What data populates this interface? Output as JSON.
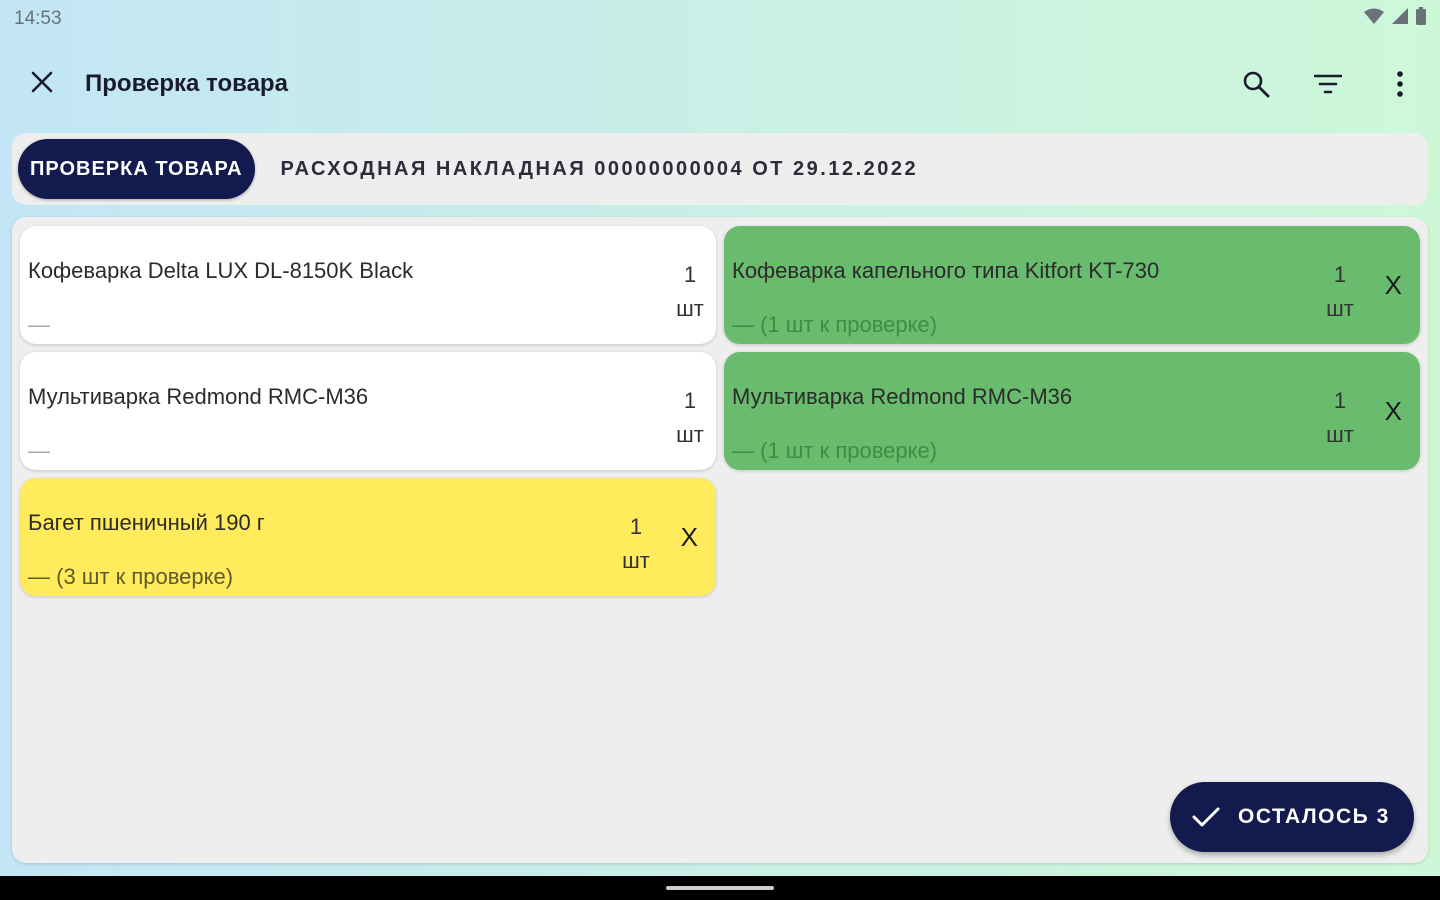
{
  "status_bar": {
    "time": "14:53",
    "icons": [
      "wifi-icon",
      "signal-icon",
      "battery-icon"
    ]
  },
  "app_bar": {
    "title": "Проверка товара",
    "actions": [
      "search-icon",
      "filter-icon",
      "more-vert-icon"
    ]
  },
  "header": {
    "chip_label": "ПРОВЕРКА ТОВАРА",
    "document_title": "РАСХОДНАЯ НАКЛАДНАЯ 00000000004 ОТ 29.12.2022"
  },
  "items": [
    {
      "name": "Кофеварка Delta LUX DL-8150K Black",
      "qty": "1",
      "unit": "шт",
      "sub": "—",
      "status": "white",
      "removable": false
    },
    {
      "name": "Кофеварка капельного типа Kitfort KT-730",
      "qty": "1",
      "unit": "шт",
      "sub": "— (1 шт к проверке)",
      "status": "green",
      "removable": true,
      "remove_label": "X"
    },
    {
      "name": "Мультиварка Redmond RMC-M36",
      "qty": "1",
      "unit": "шт",
      "sub": "—",
      "status": "white",
      "removable": false
    },
    {
      "name": "Мультиварка Redmond RMC-M36",
      "qty": "1",
      "unit": "шт",
      "sub": "— (1 шт к проверке)",
      "status": "green",
      "removable": true,
      "remove_label": "X"
    },
    {
      "name": "Багет пшеничный 190 г",
      "qty": "1",
      "unit": "шт",
      "sub": "— (3 шт к проверке)",
      "status": "yellow",
      "removable": true,
      "remove_label": "X"
    }
  ],
  "fab": {
    "label": "ОСТАЛОСЬ 3",
    "icon": "check-icon"
  },
  "colors": {
    "primary": "#121a4e",
    "checked": "#69bb6d",
    "pending": "#ffeb5b",
    "card": "#ffffff"
  }
}
